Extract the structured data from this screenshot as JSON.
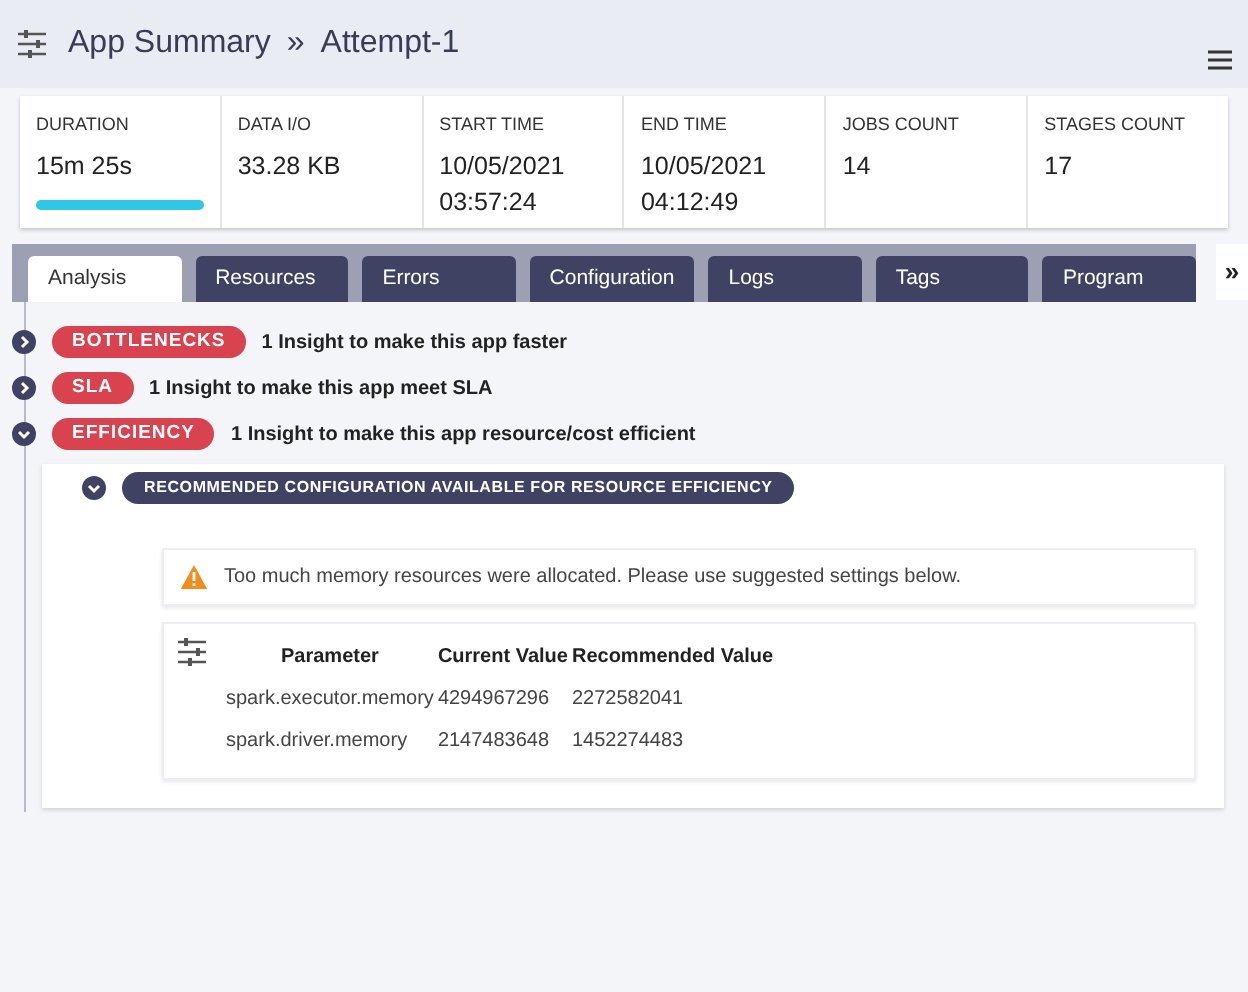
{
  "header": {
    "title": "App Summary",
    "separator": "»",
    "subtitle": "Attempt-1"
  },
  "stats": [
    {
      "label": "DURATION",
      "value": "15m 25s",
      "kind": "bar"
    },
    {
      "label": "DATA I/O",
      "value": "33.28 KB",
      "kind": "plain"
    },
    {
      "label": "START TIME",
      "value": "10/05/2021",
      "value_2": "03:57:24",
      "kind": "plain"
    },
    {
      "label": "END TIME",
      "value": "10/05/2021",
      "value_2": "04:12:49",
      "kind": "plain"
    },
    {
      "label": "JOBS COUNT",
      "value": "14",
      "kind": "plain"
    },
    {
      "label": "STAGES COUNT",
      "value": "17",
      "kind": "plain"
    }
  ],
  "tabs": [
    {
      "label": "Analysis",
      "selected": true
    },
    {
      "label": "Resources",
      "selected": false
    },
    {
      "label": "Errors",
      "selected": false
    },
    {
      "label": "Configuration",
      "selected": false
    },
    {
      "label": "Logs",
      "selected": false
    },
    {
      "label": "Tags",
      "selected": false
    },
    {
      "label": "Program",
      "selected": false
    }
  ],
  "more_tabs": "»",
  "insights": [
    {
      "tag": "BOTTLENECKS",
      "text": "1 Insight to make this app faster",
      "expanded": false
    },
    {
      "tag": "SLA",
      "text": "1 Insight to make this app meet SLA",
      "expanded": false
    },
    {
      "tag": "EFFICIENCY",
      "text": "1 Insight to make this app resource/cost efficient",
      "expanded": true,
      "detail": {
        "tag": "RECOMMENDED CONFIGURATION AVAILABLE FOR RESOURCE EFFICIENCY",
        "expanded": true,
        "alert": "Too much memory resources were allocated. Please use suggested settings below.",
        "table": {
          "columns": [
            "Parameter",
            "Current Value",
            "Recommended Value"
          ],
          "rows": [
            [
              "spark.executor.memory",
              "4294967296",
              "2272582041"
            ],
            [
              "spark.driver.memory",
              "2147483648",
              "1452274483"
            ]
          ]
        }
      }
    }
  ]
}
